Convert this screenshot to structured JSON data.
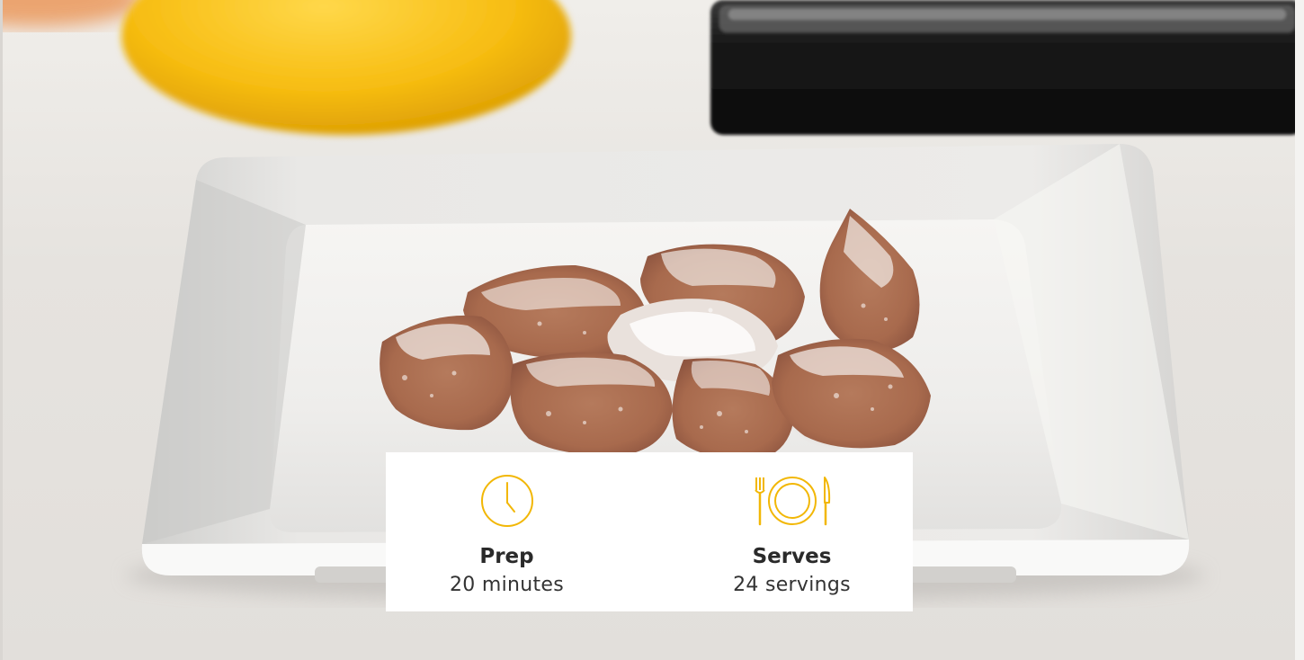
{
  "photo": {
    "subject": "candied-pieces-on-white-plate"
  },
  "info_card": {
    "items": [
      {
        "icon": "clock-icon",
        "label": "Prep",
        "value": "20 minutes"
      },
      {
        "icon": "plate-utensils-icon",
        "label": "Serves",
        "value": "24 servings"
      }
    ],
    "accent_color": "#f2b705"
  }
}
